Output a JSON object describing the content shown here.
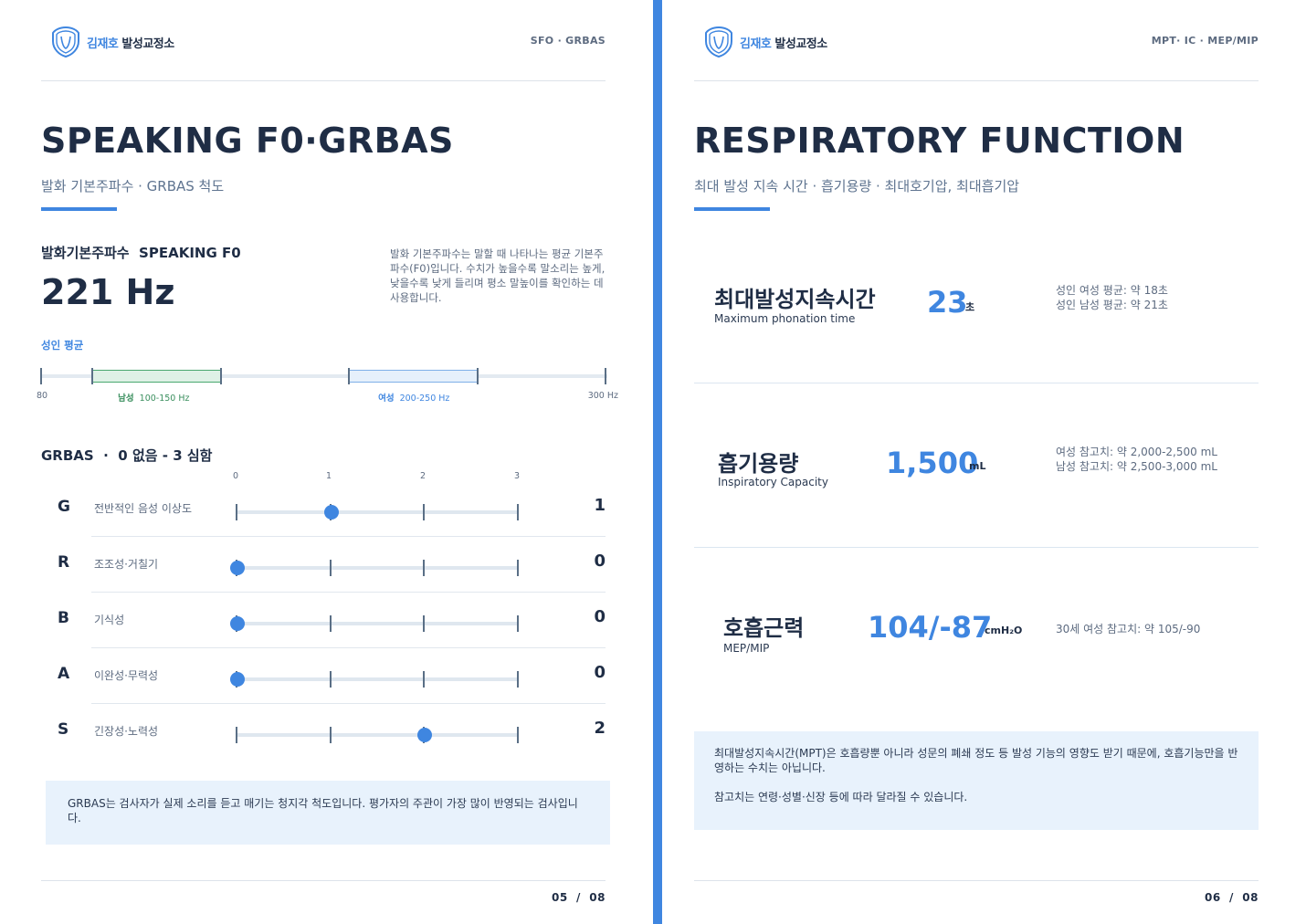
{
  "left": {
    "brand": {
      "name_accent": "김재호",
      "name_rest": "발성교정소"
    },
    "header_tag": "SFO · GRBAS",
    "title": "SPEAKING F0·GRBAS",
    "subtitle": "발화 기본주파수 · GRBAS 척도",
    "sf_label": "발화기본주파수  SPEAKING F0",
    "sf_value": "221 Hz",
    "sf_description": "발화 기본주파수는 말할 때 나타나는 평균 기본주파수(F0)입니다. 수치가 높을수록 말소리는 높게, 낮을수록 낮게 들리며 평소 말높이를 확인하는 데 사용합니다.",
    "avg_label": "성인 평균",
    "range": {
      "min_label": "80",
      "max_label": "300 Hz",
      "min": 80,
      "max": 300,
      "male": {
        "label": "남성",
        "range_text": "100-150 Hz",
        "from": 100,
        "to": 150
      },
      "female": {
        "label": "여성",
        "range_text": "200-250 Hz",
        "from": 200,
        "to": 250
      }
    },
    "grbas_title": "GRBAS  ·  0 없음 - 3 심함",
    "scale_labels": [
      "0",
      "1",
      "2",
      "3"
    ],
    "grbas": [
      {
        "letter": "G",
        "desc": "전반적인 음성 이상도",
        "score": 1
      },
      {
        "letter": "R",
        "desc": "조조성·거칠기",
        "score": 0
      },
      {
        "letter": "B",
        "desc": "기식성",
        "score": 0
      },
      {
        "letter": "A",
        "desc": "이완성·무력성",
        "score": 0
      },
      {
        "letter": "S",
        "desc": "긴장성·노력성",
        "score": 2
      }
    ],
    "note": "GRBAS는 검사자가 실제 소리를 듣고 매기는 청지각 척도입니다. 평가자의 주관이 가장 많이 반영되는 검사입니다.",
    "page_num": "05  /  08"
  },
  "right": {
    "brand": {
      "name_accent": "김재호",
      "name_rest": "발성교정소"
    },
    "header_tag": "MPT· IC · MEP/MIP",
    "title": "RESPIRATORY FUNCTION",
    "subtitle": "최대 발성 지속 시간 · 흡기용량 · 최대호기압, 최대흡기압",
    "metrics": [
      {
        "title": "최대발성지속시간",
        "sub": "Maximum phonation time",
        "value": "23",
        "unit": "초",
        "ref1": "성인 여성 평균: 약 18초",
        "ref2": "성인 남성 평균: 약 21초"
      },
      {
        "title": "흡기용량",
        "sub": "Inspiratory Capacity",
        "value": "1,500",
        "unit": "mL",
        "ref1": "여성 참고치: 약 2,000-2,500 mL",
        "ref2": "남성 참고치: 약 2,500-3,000 mL"
      },
      {
        "title": "호흡근력",
        "sub": "MEP/MIP",
        "value": "104/-87",
        "unit": "cmH₂O",
        "ref1": "30세 여성 참고치: 약 105/-90",
        "ref2": ""
      }
    ],
    "note_p1": "최대발성지속시간(MPT)은 호흡량뿐 아니라 성문의 폐쇄 정도 등 발성 기능의 영향도 받기 때문에, 호흡기능만을 반영하는 수치는 아닙니다.",
    "note_p2": "참고치는 연령·성별·신장 등에 따라 달라질 수 있습니다.",
    "page_num": "06  /  08"
  },
  "colors": {
    "accent": "#3f86e0",
    "male": "#4aa870",
    "text": "#1f2d45"
  }
}
